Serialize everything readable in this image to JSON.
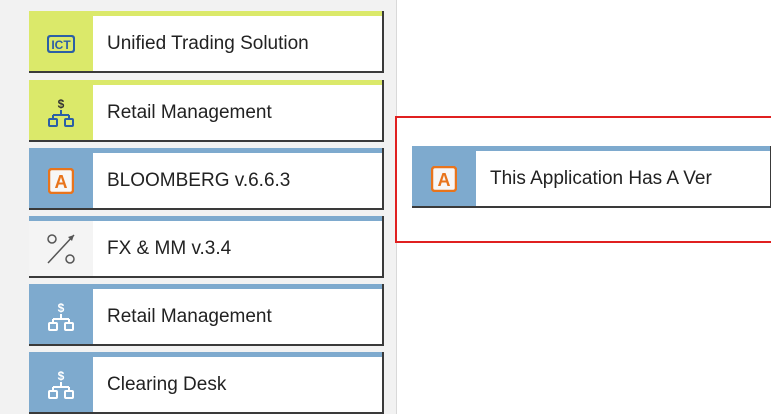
{
  "tiles": [
    {
      "label": "Unified Trading Solution",
      "icon": "ict-logo-icon",
      "color": "#dbe96a"
    },
    {
      "label": "Retail Management",
      "icon": "org-chart-dollar-icon",
      "color": "#dbe96a"
    },
    {
      "label": "BLOOMBERG v.6.6.3",
      "icon": "letter-a-app-icon",
      "color": "#7eaace"
    },
    {
      "label": "FX & MM v.3.4",
      "icon": "percent-arrow-icon",
      "color": "#7eaace"
    },
    {
      "label": "Retail Management",
      "icon": "org-chart-dollar-icon",
      "color": "#7eaace"
    },
    {
      "label": "Clearing Desk",
      "icon": "org-chart-dollar-icon",
      "color": "#7eaace"
    }
  ],
  "popup": {
    "label": "This Application Has A Ver",
    "icon": "letter-a-app-icon",
    "frame_color": "#e02020"
  },
  "ict_text": "ICT"
}
